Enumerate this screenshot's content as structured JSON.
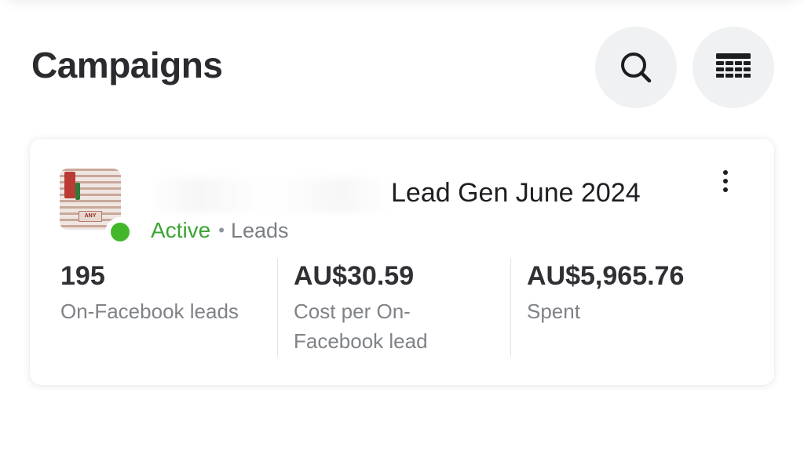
{
  "header": {
    "title": "Campaigns",
    "search_icon": "search-icon",
    "columns_icon": "table-columns-icon"
  },
  "campaign": {
    "name": "Lead Gen June 2024",
    "status": "Active",
    "separator": "•",
    "objective": "Leads",
    "status_color": "#42b72a",
    "more_icon": "more-vertical-icon",
    "thumbnail_text": "ANY",
    "metrics": [
      {
        "value": "195",
        "label": "On-Facebook leads"
      },
      {
        "value": "AU$30.59",
        "label": "Cost per On-Facebook lead"
      },
      {
        "value": "AU$5,965.76",
        "label": "Spent"
      }
    ]
  }
}
